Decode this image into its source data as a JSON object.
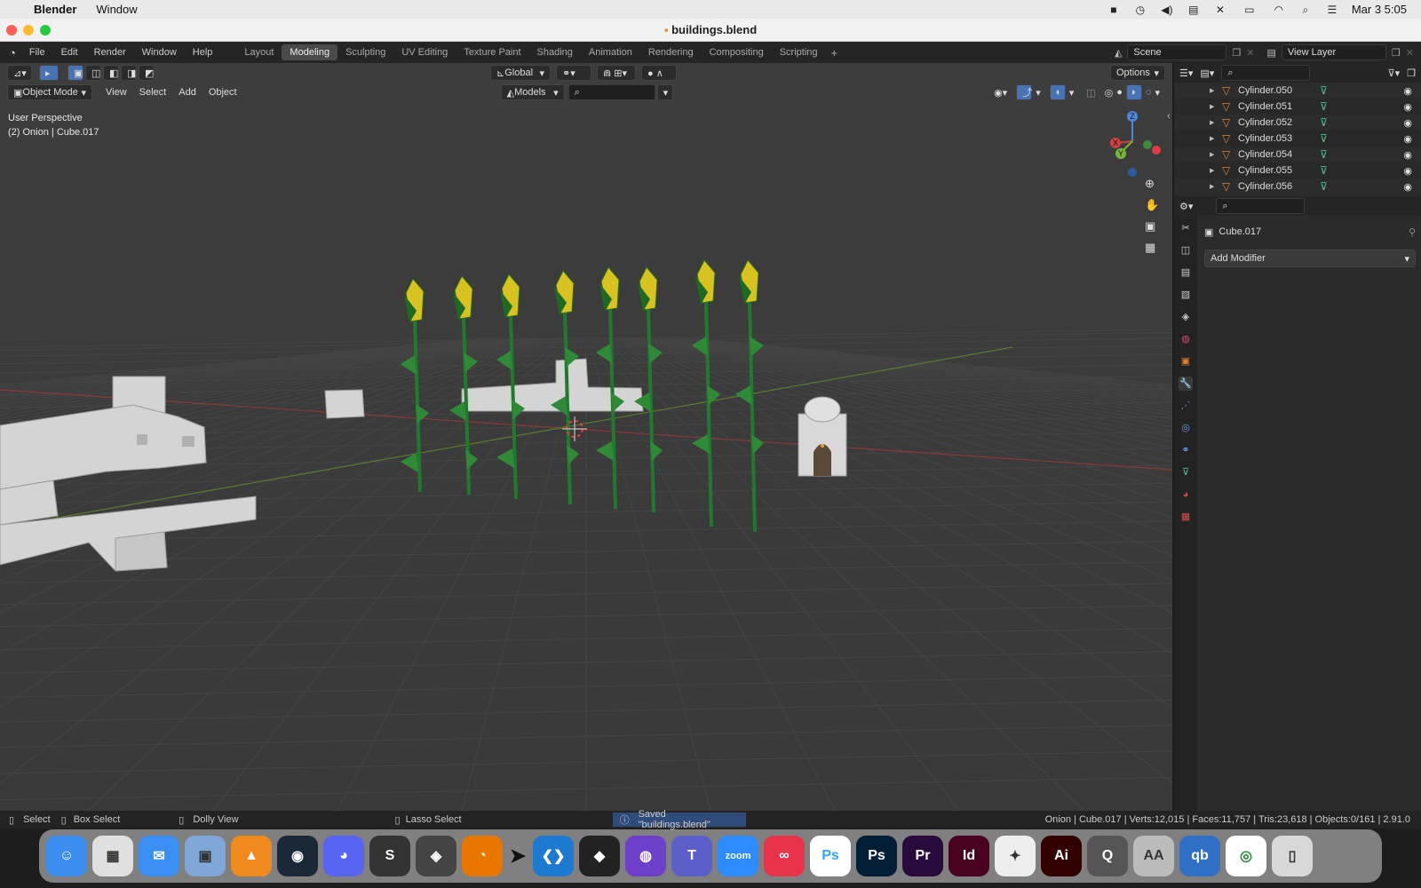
{
  "mac": {
    "app": "Blender",
    "menu": [
      "Window"
    ],
    "datetime": "Mar 3  5:05"
  },
  "window": {
    "title": "buildings.blend"
  },
  "topbar": {
    "menus": [
      "File",
      "Edit",
      "Render",
      "Window",
      "Help"
    ],
    "workspaces": [
      "Layout",
      "Modeling",
      "Sculpting",
      "UV Editing",
      "Texture Paint",
      "Shading",
      "Animation",
      "Rendering",
      "Compositing",
      "Scripting"
    ],
    "active_workspace": "Modeling",
    "scene": "Scene",
    "view_layer": "View Layer"
  },
  "viewport": {
    "transform_orientation": "Global",
    "options_label": "Options",
    "mode": "Object Mode",
    "menus": [
      "View",
      "Select",
      "Add",
      "Object"
    ],
    "collection": "Models",
    "overlay_line1": "User Perspective",
    "overlay_line2": "(2) Onion | Cube.017",
    "gizmo_z": "Z",
    "gizmo_y": "Y",
    "gizmo_x": "X"
  },
  "outliner": {
    "items": [
      "Cylinder.050",
      "Cylinder.051",
      "Cylinder.052",
      "Cylinder.053",
      "Cylinder.054",
      "Cylinder.055",
      "Cylinder.056"
    ]
  },
  "properties": {
    "object_name": "Cube.017",
    "add_modifier": "Add Modifier"
  },
  "status": {
    "select": "Select",
    "box_select": "Box Select",
    "dolly": "Dolly View",
    "lasso": "Lasso Select",
    "message": "Saved \"buildings.blend\"",
    "stats": "Onion | Cube.017 | Verts:12,015 | Faces:11,757 | Tris:23,618 | Objects:0/161 | 2.91.0"
  },
  "dock": [
    {
      "name": "finder",
      "label": "☺",
      "color": "#3b8ef0"
    },
    {
      "name": "launchpad",
      "label": "▦",
      "color": "#e0e0e0"
    },
    {
      "name": "mail",
      "label": "✉",
      "color": "#3a8ff5"
    },
    {
      "name": "preview",
      "label": "▣",
      "color": "#7fa8d8"
    },
    {
      "name": "vlc",
      "label": "▲",
      "color": "#f08a1c"
    },
    {
      "name": "steam",
      "label": "◉",
      "color": "#1b2838"
    },
    {
      "name": "discord",
      "label": "◕",
      "color": "#5865f2"
    },
    {
      "name": "sublime",
      "label": "S",
      "color": "#333333"
    },
    {
      "name": "unity",
      "label": "◈",
      "color": "#444444"
    },
    {
      "name": "blender",
      "label": "◔",
      "color": "#ea7600"
    },
    {
      "name": "cursor",
      "label": "",
      "color": "transparent"
    },
    {
      "name": "vscode",
      "label": "❮❯",
      "color": "#1e7ad1"
    },
    {
      "name": "unity-hub",
      "label": "◆",
      "color": "#222222"
    },
    {
      "name": "github",
      "label": "◍",
      "color": "#6e40c9"
    },
    {
      "name": "teams",
      "label": "T",
      "color": "#5b5fc7"
    },
    {
      "name": "zoom",
      "label": "zoom",
      "color": "#2d8cff"
    },
    {
      "name": "creative-cloud",
      "label": "∞",
      "color": "#e8334a"
    },
    {
      "name": "photoshop-beta",
      "label": "Ps",
      "color": "#ffffff"
    },
    {
      "name": "photoshop",
      "label": "Ps",
      "color": "#001e36"
    },
    {
      "name": "premiere",
      "label": "Pr",
      "color": "#2a0a3d"
    },
    {
      "name": "indesign",
      "label": "Id",
      "color": "#49021f"
    },
    {
      "name": "acrobat",
      "label": "✦",
      "color": "#eeeeee"
    },
    {
      "name": "illustrator",
      "label": "Ai",
      "color": "#330000"
    },
    {
      "name": "quicktime",
      "label": "Q",
      "color": "#555555"
    },
    {
      "name": "font-book",
      "label": "AA",
      "color": "#bbbbbb"
    },
    {
      "name": "qbittorrent",
      "label": "qb",
      "color": "#2f6fc6"
    },
    {
      "name": "chrome",
      "label": "◎",
      "color": "#ffffff"
    },
    {
      "name": "trash",
      "label": "▯",
      "color": "#d8d8d8"
    }
  ]
}
